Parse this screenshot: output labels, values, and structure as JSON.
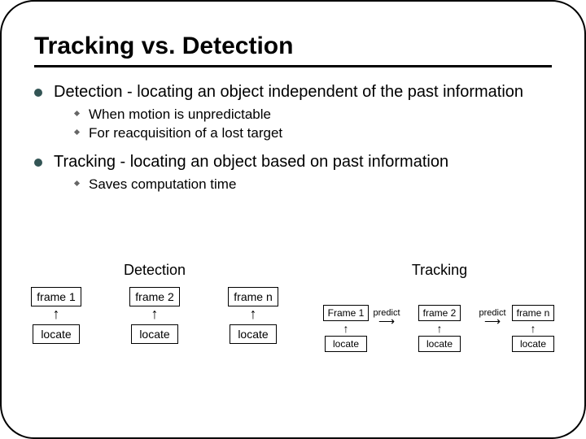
{
  "title": "Tracking vs. Detection",
  "bullets": [
    {
      "text": "Detection - locating an object independent of the past information",
      "sub": [
        "When motion is unpredictable",
        "For reacquisition of a lost target"
      ]
    },
    {
      "text": "Tracking - locating an object based on past information",
      "sub": [
        "Saves computation time"
      ]
    }
  ],
  "diagram": {
    "detection": {
      "label": "Detection",
      "frames": [
        "frame 1",
        "frame 2",
        "frame n"
      ],
      "action": "locate"
    },
    "tracking": {
      "label": "Tracking",
      "frames": [
        "Frame 1",
        "frame 2",
        "frame n"
      ],
      "action": "locate",
      "edge": "predict"
    }
  }
}
